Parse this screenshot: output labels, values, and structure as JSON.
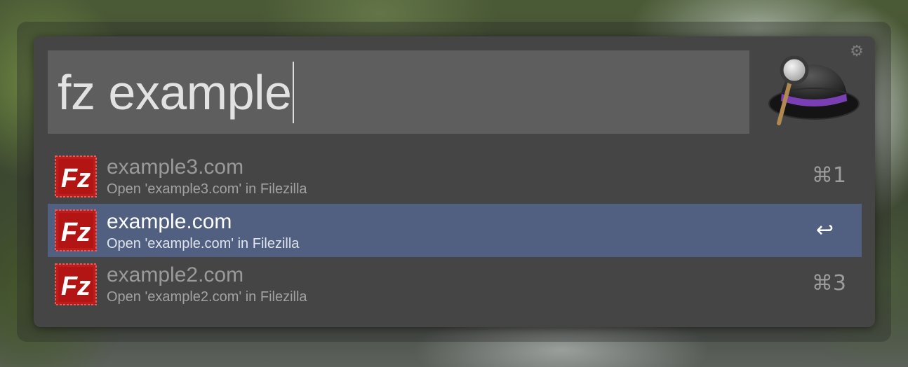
{
  "search": {
    "query": "fz example"
  },
  "icons": {
    "settings": "gear-icon",
    "app_logo": "alfred-hat-logo",
    "result_icon": "filezilla-icon",
    "filezilla_letters": "Fz"
  },
  "colors": {
    "panel": "#454545",
    "search_field": "#5e5e5e",
    "selection": "#516080",
    "filezilla_red": "#bf1c1c"
  },
  "results": [
    {
      "title": "example3.com",
      "subtitle": "Open 'example3.com' in Filezilla",
      "shortcut": "⌘1",
      "selected": false
    },
    {
      "title": "example.com",
      "subtitle": "Open 'example.com' in Filezilla",
      "shortcut": "↩",
      "selected": true
    },
    {
      "title": "example2.com",
      "subtitle": "Open 'example2.com' in Filezilla",
      "shortcut": "⌘3",
      "selected": false
    }
  ]
}
